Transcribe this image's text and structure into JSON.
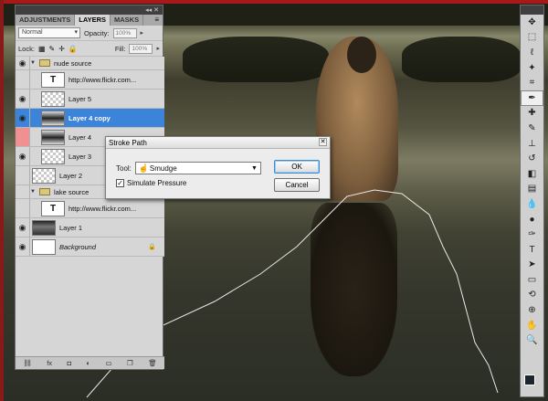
{
  "layers_panel": {
    "tabs": [
      "ADJUSTMENTS",
      "LAYERS",
      "MASKS"
    ],
    "active_tab": "LAYERS",
    "blend_mode": "Normal",
    "opacity_label": "Opacity:",
    "opacity_value": "100%",
    "lock_label": "Lock:",
    "fill_label": "Fill:",
    "fill_value": "100%",
    "layers": [
      {
        "name": "nude source",
        "kind": "group",
        "visible": true,
        "expanded": true
      },
      {
        "name": "http://www.flickr.com...",
        "kind": "text",
        "visible": false
      },
      {
        "name": "Layer 5",
        "kind": "pixel",
        "visible": true
      },
      {
        "name": "Layer 4 copy",
        "kind": "pixel",
        "visible": true,
        "selected": true
      },
      {
        "name": "Layer 4",
        "kind": "pixel",
        "visible": true
      },
      {
        "name": "Layer 3",
        "kind": "pixel",
        "visible": true
      },
      {
        "name": "Layer 2",
        "kind": "pixel",
        "visible": false
      },
      {
        "name": "lake source",
        "kind": "group",
        "visible": false,
        "expanded": true
      },
      {
        "name": "http://www.flickr.com...",
        "kind": "text",
        "visible": false
      },
      {
        "name": "Layer 1",
        "kind": "photo",
        "visible": true
      },
      {
        "name": "Background",
        "kind": "background",
        "visible": true,
        "locked": true
      }
    ]
  },
  "dialog": {
    "title": "Stroke Path",
    "tool_label": "Tool:",
    "tool_value": "Smudge",
    "simulate_pressure_label": "Simulate Pressure",
    "simulate_pressure_checked": true,
    "ok_label": "OK",
    "cancel_label": "Cancel"
  },
  "tools": [
    "move-icon",
    "marquee-icon",
    "lasso-icon",
    "quick-select-icon",
    "crop-icon",
    "eyedropper-icon",
    "healing-icon",
    "brush-icon",
    "stamp-icon",
    "history-brush-icon",
    "eraser-icon",
    "gradient-icon",
    "blur-icon",
    "dodge-icon",
    "pen-icon",
    "type-icon",
    "path-select-icon",
    "shape-icon",
    "3d-rotate-icon",
    "3d-orbit-icon",
    "hand-icon",
    "zoom-icon"
  ],
  "colors": {
    "foreground": "#1e2430",
    "background": "#ffffff",
    "selection": "#3b84d9"
  }
}
